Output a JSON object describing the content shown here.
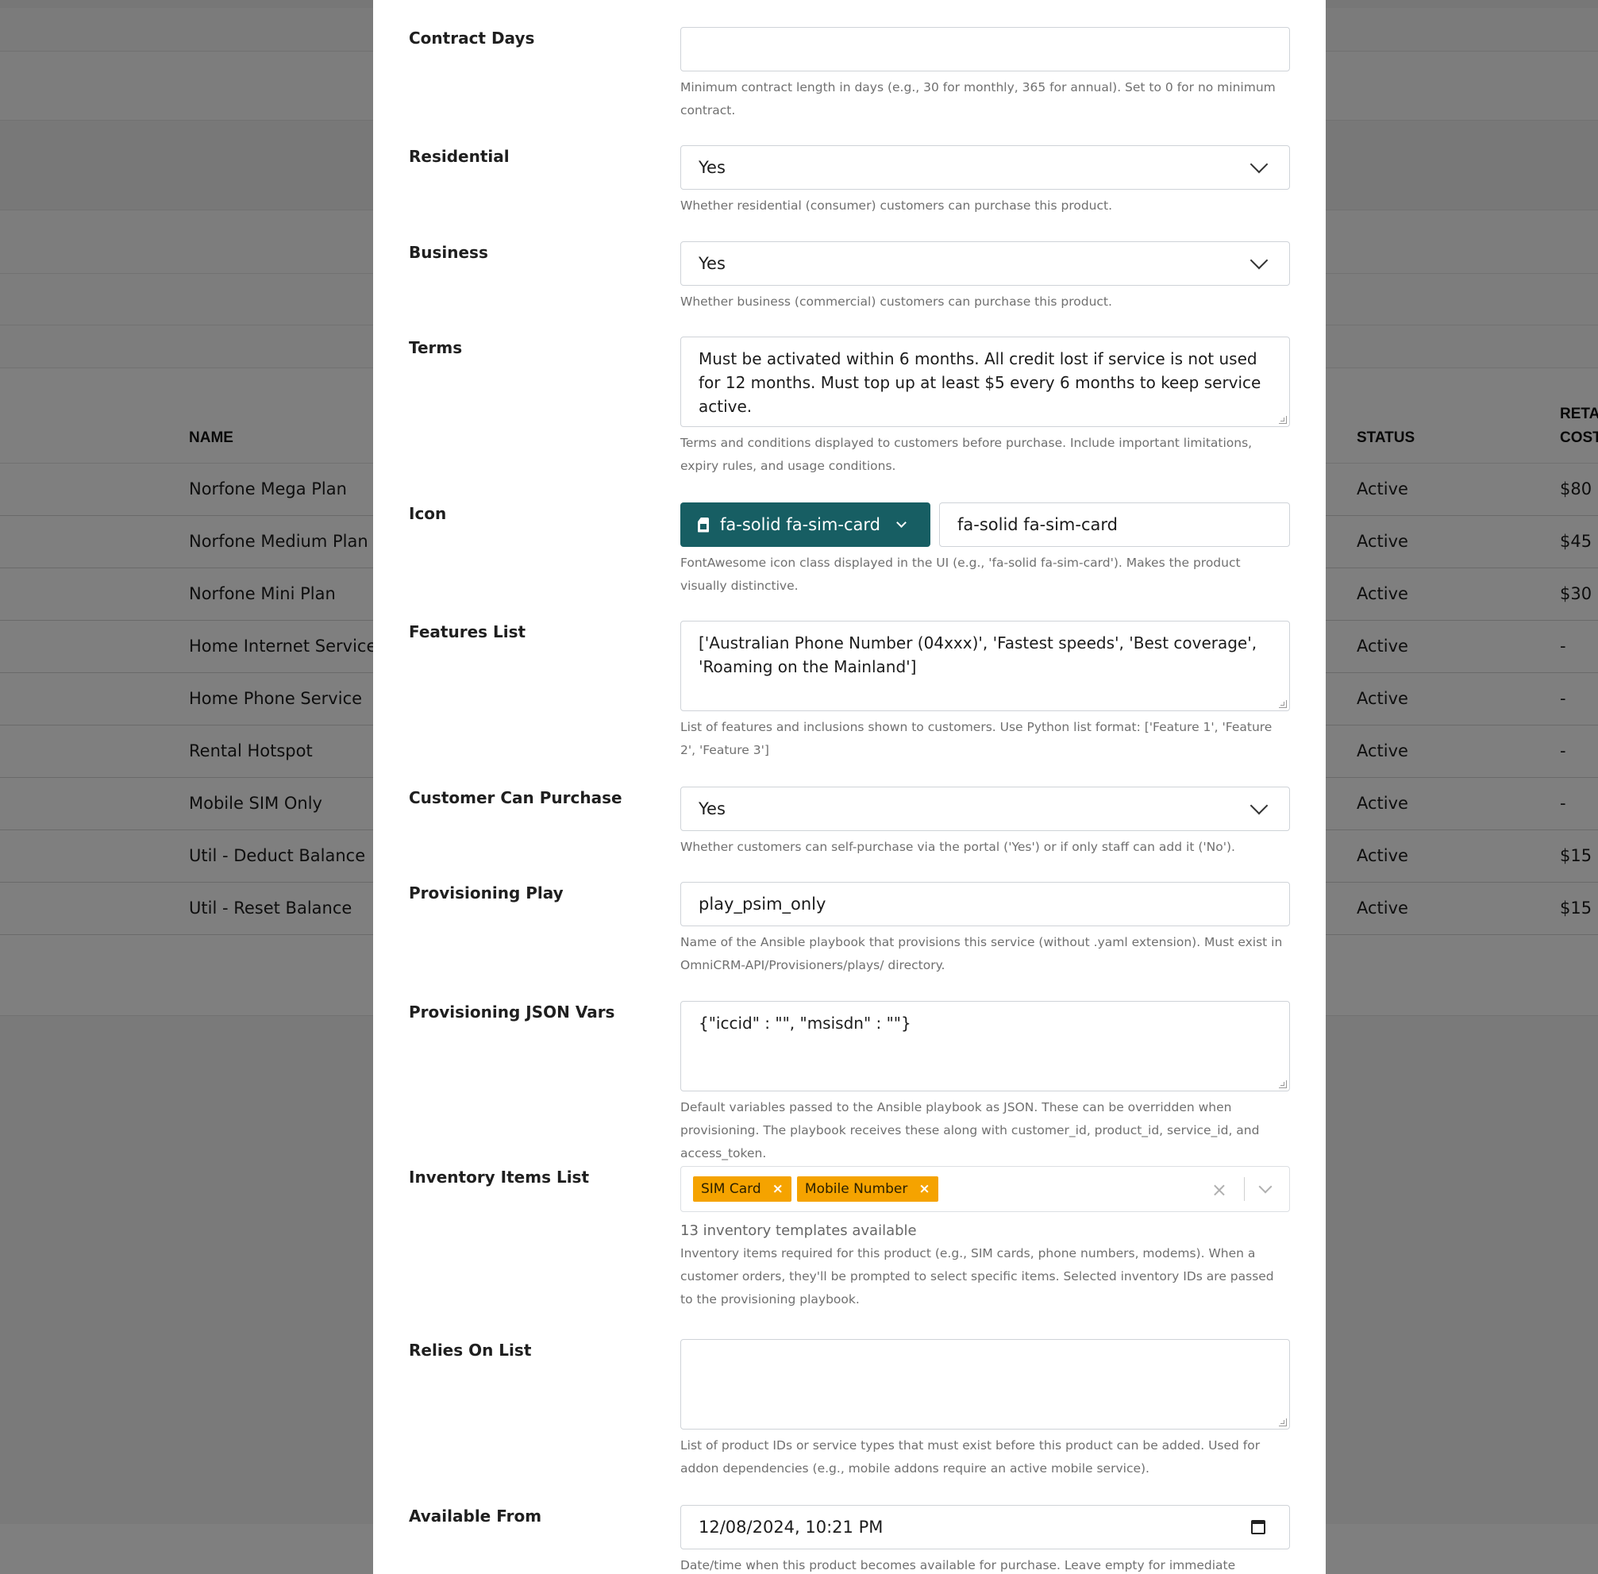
{
  "background_table": {
    "headers": [
      "NAME",
      "STATUS",
      "RETA",
      "COST"
    ],
    "rows": [
      {
        "name": "Norfone Mega Plan",
        "status": "Active",
        "cost": "$80"
      },
      {
        "name": "Norfone Medium Plan",
        "status": "Active",
        "cost": "$45"
      },
      {
        "name": "Norfone Mini Plan",
        "status": "Active",
        "cost": "$30"
      },
      {
        "name": "Home Internet Service (I",
        "status": "Active",
        "cost": "-"
      },
      {
        "name": "Home Phone Service",
        "status": "Active",
        "cost": "-"
      },
      {
        "name": "Rental Hotspot",
        "status": "Active",
        "cost": "-"
      },
      {
        "name": "Mobile SIM Only",
        "status": "Active",
        "cost": "-"
      },
      {
        "name": "Util - Deduct Balance",
        "status": "Active",
        "cost": "$15"
      },
      {
        "name": "Util - Reset Balance",
        "status": "Active",
        "cost": "$15"
      }
    ]
  },
  "form": {
    "contract_days": {
      "label": "Contract Days",
      "value": "",
      "help": "Minimum contract length in days (e.g., 30 for monthly, 365 for annual). Set to 0 for no minimum contract."
    },
    "residential": {
      "label": "Residential",
      "value": "Yes",
      "help": "Whether residential (consumer) customers can purchase this product."
    },
    "business": {
      "label": "Business",
      "value": "Yes",
      "help": "Whether business (commercial) customers can purchase this product."
    },
    "terms": {
      "label": "Terms",
      "value": "Must be activated within 6 months. All credit lost if service is not used for 12 months. Must top up at least $5 every 6 months to keep service active.",
      "help": "Terms and conditions displayed to customers before purchase. Include important limitations, expiry rules, and usage conditions."
    },
    "icon": {
      "label": "Icon",
      "picker_label": "fa-solid fa-sim-card",
      "value": "fa-solid fa-sim-card",
      "help": "FontAwesome icon class displayed in the UI (e.g., 'fa-solid fa-sim-card'). Makes the product visually distinctive."
    },
    "features": {
      "label": "Features List",
      "value": "['Australian Phone Number (04xxx)', 'Fastest speeds', 'Best coverage', 'Roaming on the Mainland']",
      "help": "List of features and inclusions shown to customers. Use Python list format: ['Feature 1', 'Feature 2', 'Feature 3']"
    },
    "customer_can_purchase": {
      "label": "Customer Can Purchase",
      "value": "Yes",
      "help": "Whether customers can self-purchase via the portal ('Yes') or if only staff can add it ('No')."
    },
    "provisioning_play": {
      "label": "Provisioning Play",
      "value": "play_psim_only",
      "help": "Name of the Ansible playbook that provisions this service (without .yaml extension). Must exist in OmniCRM-API/Provisioners/plays/ directory."
    },
    "provisioning_json": {
      "label": "Provisioning JSON Vars",
      "value": "{\"iccid\" : \"\", \"msisdn\" : \"\"}",
      "help": "Default variables passed to the Ansible playbook as JSON. These can be overridden when provisioning. The playbook receives these along with customer_id, product_id, service_id, and access_token."
    },
    "inventory": {
      "label": "Inventory Items List",
      "chips": [
        "SIM Card",
        "Mobile Number"
      ],
      "chip_remove": "×",
      "clear": "×",
      "count": "13 inventory templates available",
      "help": "Inventory items required for this product (e.g., SIM cards, phone numbers, modems). When a customer orders, they'll be prompted to select specific items. Selected inventory IDs are passed to the provisioning playbook."
    },
    "relies_on": {
      "label": "Relies On List",
      "value": "",
      "help": "List of product IDs or service types that must exist before this product can be added. Used for addon dependencies (e.g., mobile addons require an active mobile service)."
    },
    "available_from": {
      "label": "Available From",
      "value": "12/08/2024, 10:21 PM",
      "help": "Date/time when this product becomes available for purchase. Leave empty for immediate availability."
    }
  }
}
